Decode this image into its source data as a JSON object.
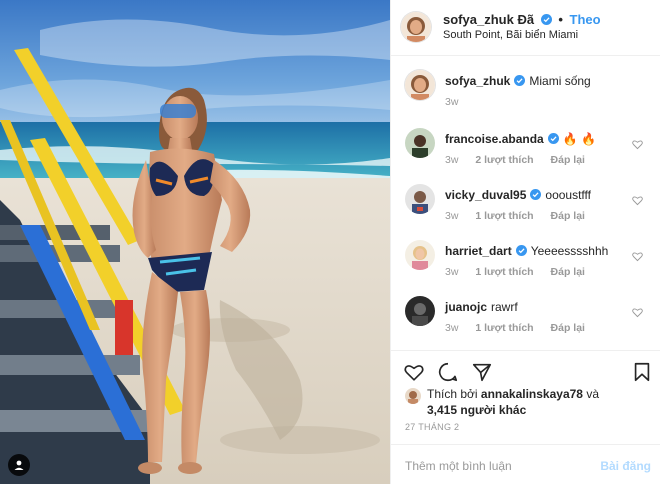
{
  "post": {
    "username": "sofya_zhuk",
    "header_suffix": "Đã",
    "follow_label": "Theo",
    "separator": "•",
    "location": "South Point, Bãi biển Miami"
  },
  "caption": {
    "username": "sofya_zhuk",
    "text": "Miami sống",
    "time": "3w"
  },
  "comments": [
    {
      "username": "francoise.abanda",
      "verified": true,
      "text": "🔥 🔥",
      "time": "3w",
      "likes": "2 lượt thích",
      "reply": "Đáp lại"
    },
    {
      "username": "vicky_duval95",
      "verified": true,
      "text": "oooustfff",
      "time": "3w",
      "likes": "1 lượt thích",
      "reply": "Đáp lại"
    },
    {
      "username": "harriet_dart",
      "verified": true,
      "text": "Yeeeesssshhh",
      "time": "3w",
      "likes": "1 lượt thích",
      "reply": "Đáp lại"
    },
    {
      "username": "juanojc",
      "verified": false,
      "text": "rawrf",
      "time": "3w",
      "likes": "1 lượt thích",
      "reply": "Đáp lại"
    }
  ],
  "likes": {
    "prefix": "Thích bởi",
    "user": "annakalinskaya78",
    "conj": "và",
    "count": "3,415 người khác"
  },
  "date": "27 THÁNG 2",
  "add_comment": {
    "placeholder": "Thêm một bình luận",
    "post_label": "Bài đăng"
  },
  "icons": {
    "like": "heart-icon",
    "comment": "comment-icon",
    "share": "send-icon",
    "save": "bookmark-icon",
    "tag": "user-tag-icon",
    "verified": "verified-badge-icon"
  },
  "colors": {
    "link": "#3897f0",
    "verified": "#3897f0",
    "muted": "#999999",
    "post_disabled": "#b3dbff"
  }
}
